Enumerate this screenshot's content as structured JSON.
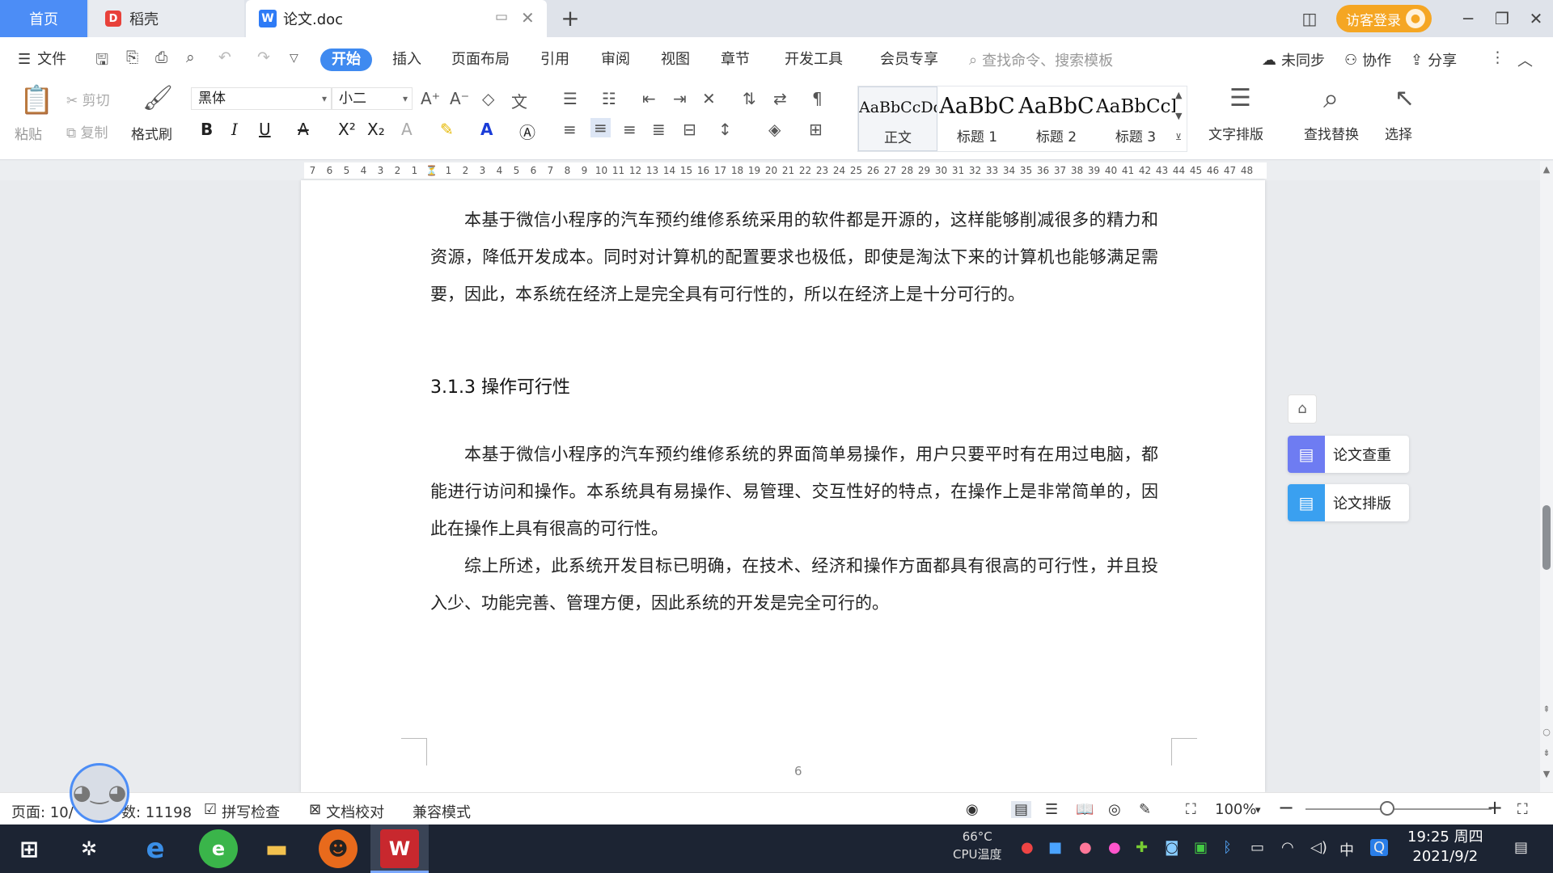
{
  "tabs": {
    "home": "首页",
    "daoke": "稻壳",
    "doc": "论文.doc"
  },
  "window": {
    "login": "访客登录"
  },
  "menu": {
    "file": "文件",
    "items": [
      "开始",
      "插入",
      "页面布局",
      "引用",
      "审阅",
      "视图",
      "章节",
      "开发工具",
      "会员专享"
    ],
    "search_placeholder": "查找命令、搜索模板",
    "unsynced": "未同步",
    "collab": "协作",
    "share": "分享"
  },
  "ribbon": {
    "paste": "粘贴",
    "cut": "剪切",
    "copy": "复制",
    "format_painter": "格式刷",
    "font_name": "黑体",
    "font_size": "小二",
    "styles": [
      {
        "sample": "AaBbCcDd",
        "name": "正文"
      },
      {
        "sample": "AaBbC",
        "name": "标题 1"
      },
      {
        "sample": "AaBbC",
        "name": "标题 2"
      },
      {
        "sample": "AaBbCcI",
        "name": "标题 3"
      }
    ],
    "text_layout": "文字排版",
    "find_replace": "查找替换",
    "select": "选择"
  },
  "ruler_left": [
    "7",
    "6",
    "5",
    "4",
    "3",
    "2",
    "1"
  ],
  "ruler_right": [
    "1",
    "2",
    "3",
    "4",
    "5",
    "6",
    "7",
    "8",
    "9",
    "10",
    "11",
    "12",
    "13",
    "14",
    "15",
    "16",
    "17",
    "18",
    "19",
    "20",
    "21",
    "22",
    "23",
    "24",
    "25",
    "26",
    "27",
    "28",
    "29",
    "30",
    "31",
    "32",
    "33",
    "34",
    "35",
    "36",
    "37",
    "38",
    "39",
    "40",
    "41",
    "42",
    "43",
    "44",
    "45",
    "46",
    "47",
    "48"
  ],
  "document": {
    "para1": "本基于微信小程序的汽车预约维修系统采用的软件都是开源的，这样能够削减很多的精力和资源，降低开发成本。同时对计算机的配置要求也极低，即使是淘汰下来的计算机也能够满足需要，因此，本系统在经济上是完全具有可行性的，所以在经济上是十分可行的。",
    "heading": "3.1.3 操作可行性",
    "para2": "本基于微信小程序的汽车预约维修系统的界面简单易操作，用户只要平时有在用过电脑，都能进行访问和操作。本系统具有易操作、易管理、交互性好的特点，在操作上是非常简单的，因此在操作上具有很高的可行性。",
    "para3": "综上所述，此系统开发目标已明确，在技术、经济和操作方面都具有很高的可行性，并且投入少、功能完善、管理方便，因此系统的开发是完全可行的。",
    "page_number": "6"
  },
  "side_panel": {
    "check": "论文查重",
    "layout": "论文排版"
  },
  "status": {
    "page": "页面: 10/",
    "words": "数: 11198",
    "spell": "拼写检查",
    "proof": "文档校对",
    "compat": "兼容模式",
    "zoom": "100%"
  },
  "taskbar": {
    "cpu_temp": "66°C",
    "cpu_label": "CPU温度",
    "ime": "中",
    "time": "19:25 周四",
    "date": "2021/9/2"
  },
  "colors": {
    "accent": "#3f8af0",
    "home_tab": "#4c8df6",
    "login": "#f5a623",
    "check_btn": "#6e7cf2",
    "layout_btn": "#3aa0f0"
  }
}
